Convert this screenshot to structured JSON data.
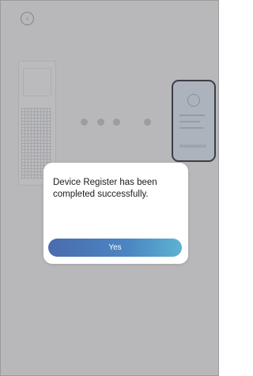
{
  "header": {
    "back_icon": "chevron-left-icon",
    "back_glyph": "‹"
  },
  "illustration": {
    "device": "air-purifier",
    "phone": "smartphone",
    "progress_dots": 4
  },
  "dialog": {
    "message": "Device Register has been completed successfully.",
    "confirm_label": "Yes",
    "button_gradient": [
      "#4a6cae",
      "#5cb3d3"
    ]
  },
  "colors": {
    "background": "#f2f2f4",
    "overlay": "#5a5a5f",
    "dialog": "#ffffff"
  }
}
